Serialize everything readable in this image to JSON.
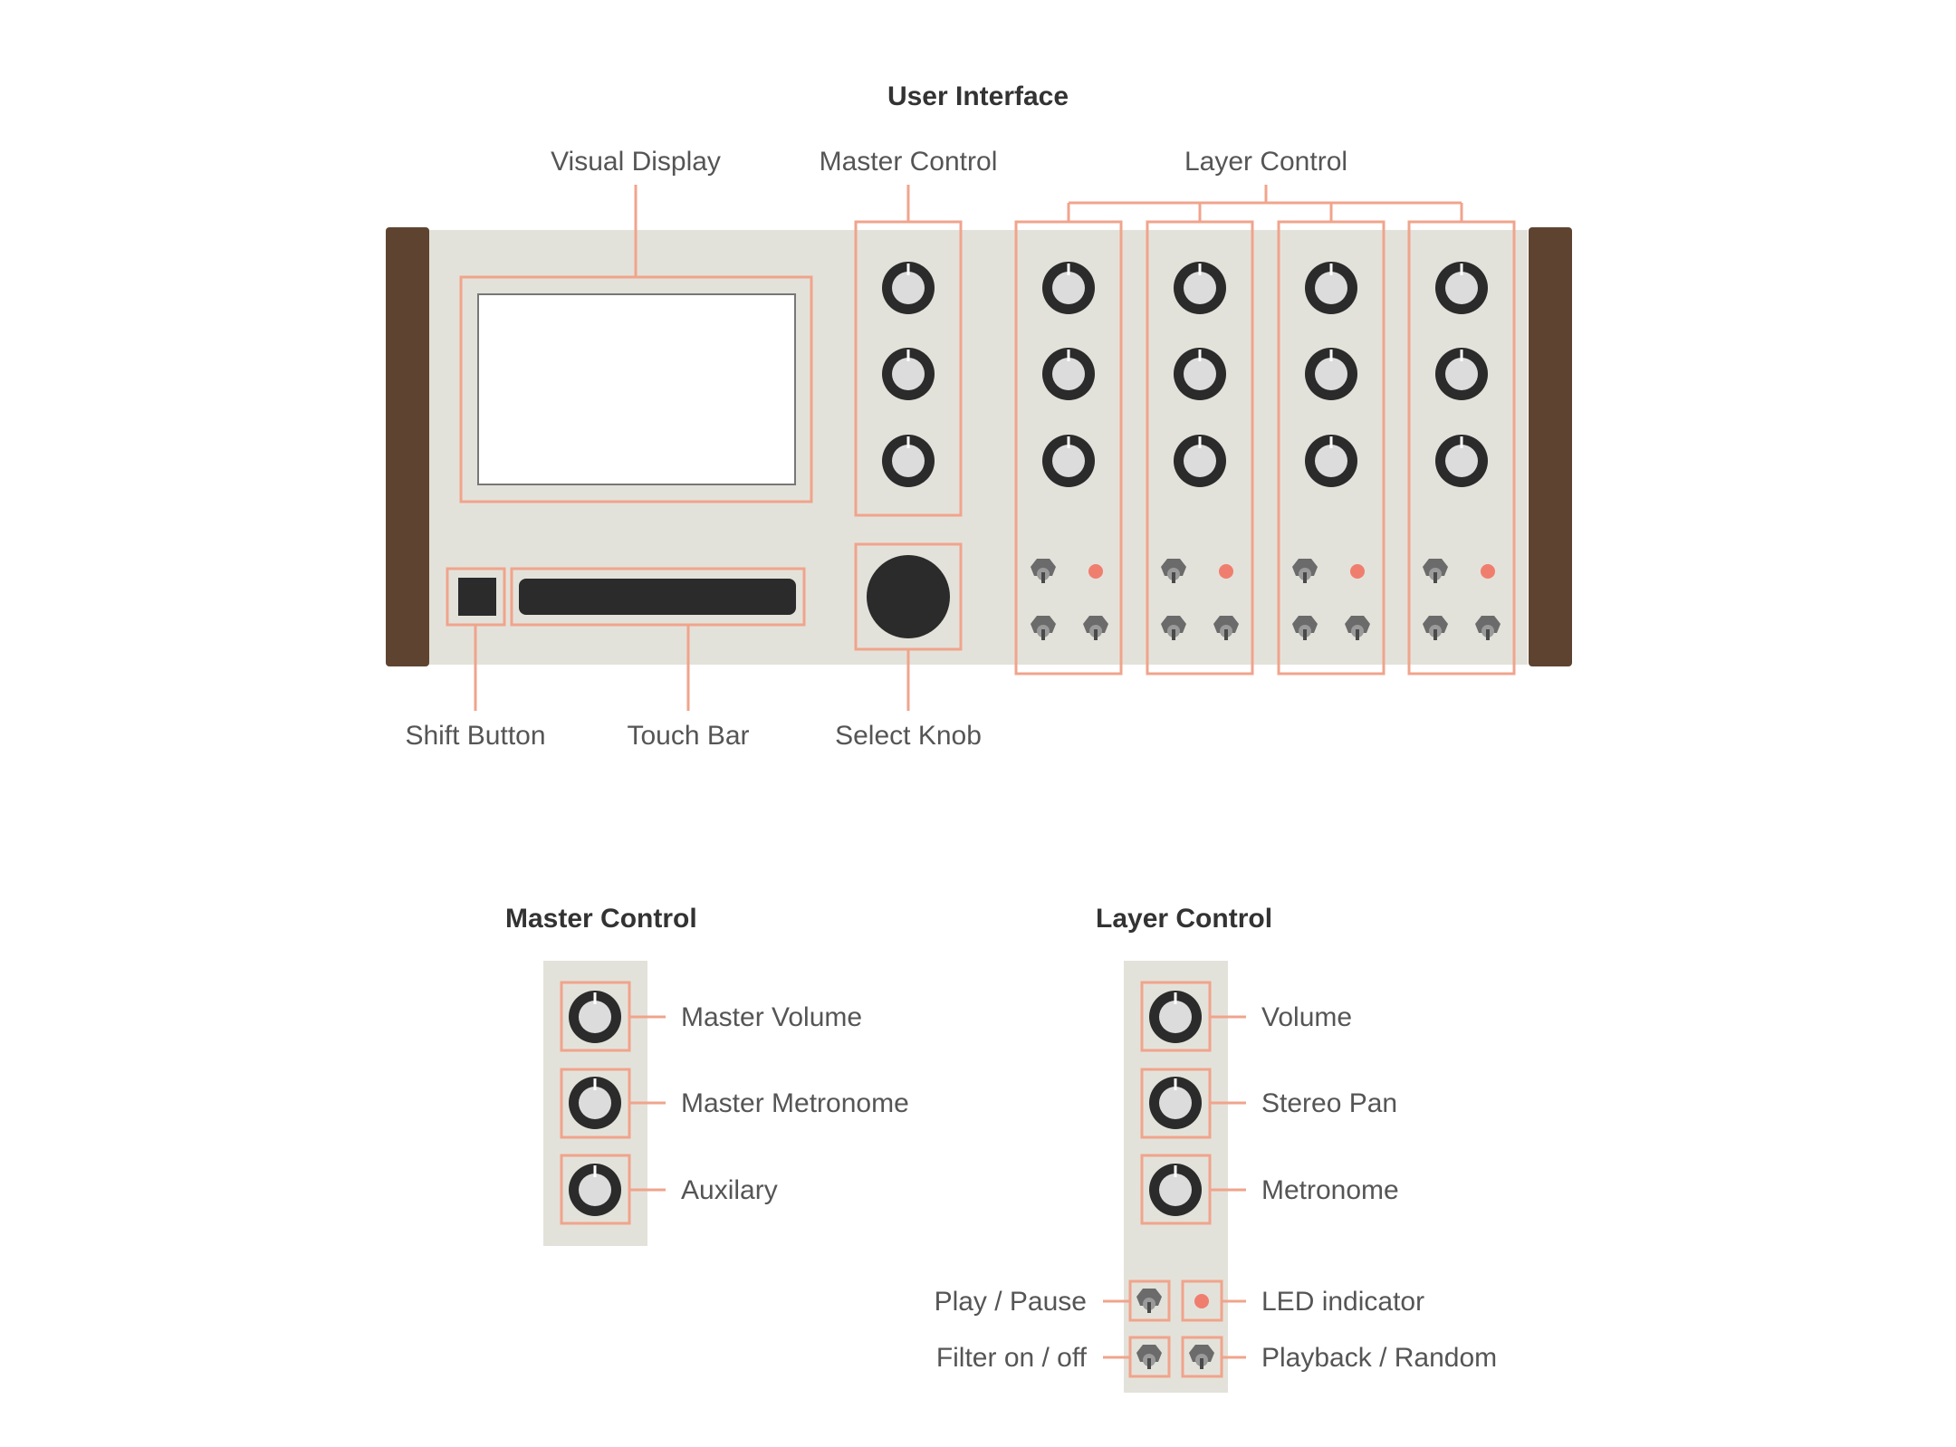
{
  "diagram": {
    "title": "User Interface",
    "labels": {
      "visual_display": "Visual Display",
      "master_control": "Master Control",
      "layer_control": "Layer Control",
      "shift_button": "Shift Button",
      "touch_bar": "Touch Bar",
      "select_knob": "Select Knob"
    },
    "layer_count": 4
  },
  "master_detail": {
    "title": "Master Control",
    "knobs": [
      "Master Volume",
      "Master Metronome",
      "Auxilary"
    ]
  },
  "layer_detail": {
    "title": "Layer Control",
    "knobs": [
      "Volume",
      "Stereo Pan",
      "Metronome"
    ],
    "play_pause": "Play / Pause",
    "led_indicator": "LED indicator",
    "filter": "Filter on / off",
    "playback": "Playback / Random"
  },
  "colors": {
    "panel": "#e3e2da",
    "wood": "#5e4430",
    "accent": "#f0a48c",
    "led": "#f07e6e",
    "knob_dark": "#2b2b2b",
    "knob_light": "#dcdcdc",
    "text": "#555555",
    "title_text": "#333333"
  }
}
